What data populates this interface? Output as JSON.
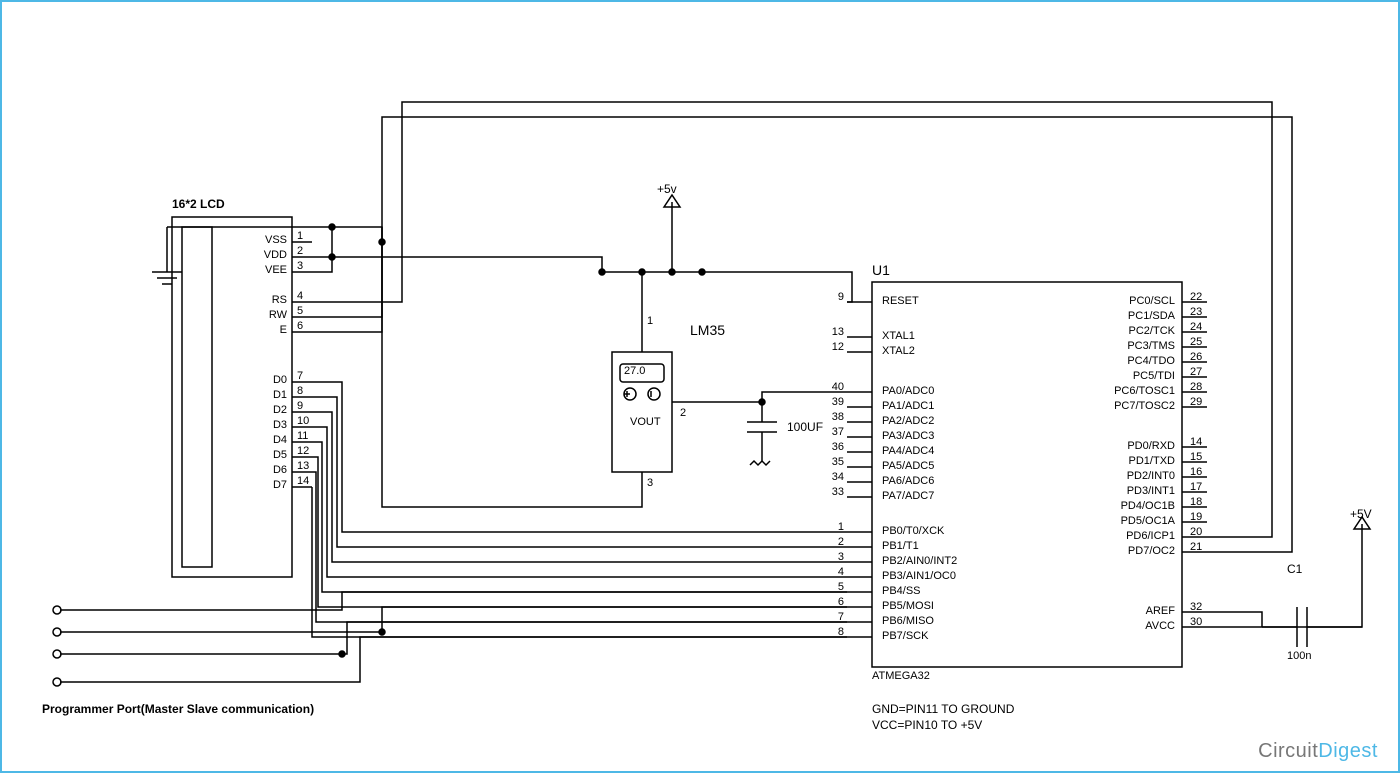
{
  "lcd": {
    "title": "16*2 LCD",
    "pins": [
      {
        "n": "1",
        "name": "VSS"
      },
      {
        "n": "2",
        "name": "VDD"
      },
      {
        "n": "3",
        "name": "VEE"
      },
      {
        "n": "4",
        "name": "RS"
      },
      {
        "n": "5",
        "name": "RW"
      },
      {
        "n": "6",
        "name": "E"
      },
      {
        "n": "7",
        "name": "D0"
      },
      {
        "n": "8",
        "name": "D1"
      },
      {
        "n": "9",
        "name": "D2"
      },
      {
        "n": "10",
        "name": "D3"
      },
      {
        "n": "11",
        "name": "D4"
      },
      {
        "n": "12",
        "name": "D5"
      },
      {
        "n": "13",
        "name": "D6"
      },
      {
        "n": "14",
        "name": "D7"
      }
    ]
  },
  "sensor": {
    "name": "LM35",
    "display": "27.0",
    "vout": "VOUT",
    "supply": "+5v",
    "pin1": "1",
    "pin2": "2",
    "pin3": "3"
  },
  "cap1": {
    "value": "100UF"
  },
  "cap2": {
    "ref": "C1",
    "value": "100n",
    "supply": "+5V"
  },
  "mcu": {
    "ref": "U1",
    "part": "ATMEGA32",
    "left": [
      {
        "n": "9",
        "name": "RESET"
      },
      {
        "n": "13",
        "name": "XTAL1"
      },
      {
        "n": "12",
        "name": "XTAL2"
      },
      {
        "n": "40",
        "name": "PA0/ADC0"
      },
      {
        "n": "39",
        "name": "PA1/ADC1"
      },
      {
        "n": "38",
        "name": "PA2/ADC2"
      },
      {
        "n": "37",
        "name": "PA3/ADC3"
      },
      {
        "n": "36",
        "name": "PA4/ADC4"
      },
      {
        "n": "35",
        "name": "PA5/ADC5"
      },
      {
        "n": "34",
        "name": "PA6/ADC6"
      },
      {
        "n": "33",
        "name": "PA7/ADC7"
      },
      {
        "n": "1",
        "name": "PB0/T0/XCK"
      },
      {
        "n": "2",
        "name": "PB1/T1"
      },
      {
        "n": "3",
        "name": "PB2/AIN0/INT2"
      },
      {
        "n": "4",
        "name": "PB3/AIN1/OC0"
      },
      {
        "n": "5",
        "name": "PB4/SS"
      },
      {
        "n": "6",
        "name": "PB5/MOSI"
      },
      {
        "n": "7",
        "name": "PB6/MISO"
      },
      {
        "n": "8",
        "name": "PB7/SCK"
      }
    ],
    "right": [
      {
        "n": "22",
        "name": "PC0/SCL"
      },
      {
        "n": "23",
        "name": "PC1/SDA"
      },
      {
        "n": "24",
        "name": "PC2/TCK"
      },
      {
        "n": "25",
        "name": "PC3/TMS"
      },
      {
        "n": "26",
        "name": "PC4/TDO"
      },
      {
        "n": "27",
        "name": "PC5/TDI"
      },
      {
        "n": "28",
        "name": "PC6/TOSC1"
      },
      {
        "n": "29",
        "name": "PC7/TOSC2"
      },
      {
        "n": "14",
        "name": "PD0/RXD"
      },
      {
        "n": "15",
        "name": "PD1/TXD"
      },
      {
        "n": "16",
        "name": "PD2/INT0"
      },
      {
        "n": "17",
        "name": "PD3/INT1"
      },
      {
        "n": "18",
        "name": "PD4/OC1B"
      },
      {
        "n": "19",
        "name": "PD5/OC1A"
      },
      {
        "n": "20",
        "name": "PD6/ICP1"
      },
      {
        "n": "21",
        "name": "PD7/OC2"
      },
      {
        "n": "32",
        "name": "AREF"
      },
      {
        "n": "30",
        "name": "AVCC"
      }
    ]
  },
  "notes": {
    "port": "Programmer Port(Master Slave communication)",
    "gnd": "GND=PIN11 TO GROUND",
    "vcc": "VCC=PIN10 TO +5V"
  },
  "brand": {
    "a": "Circuit",
    "b": "Digest"
  },
  "colors": {
    "frame": "#4eb8e6",
    "wire": "#000"
  }
}
